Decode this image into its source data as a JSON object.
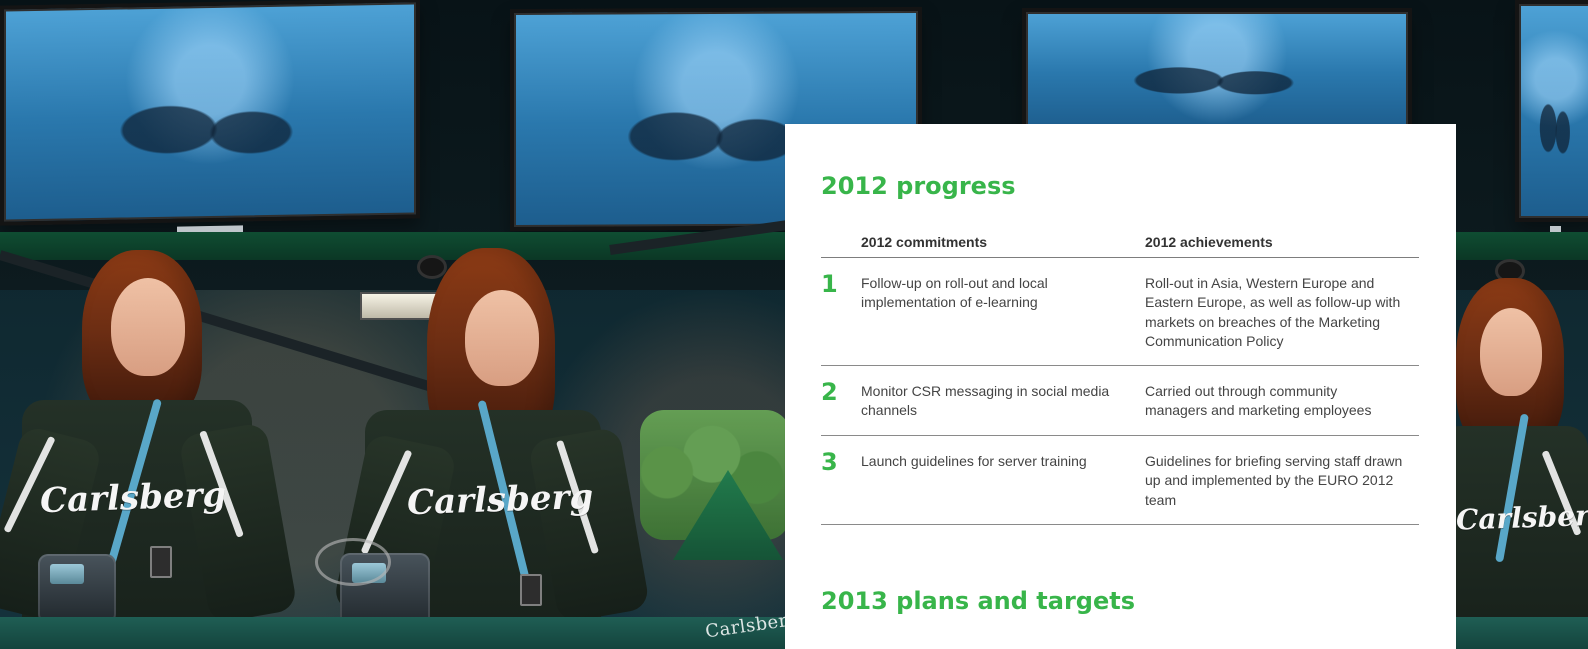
{
  "colors": {
    "accent_green": "#38b54a",
    "card_background": "#ffffff",
    "text_dark": "#444444"
  },
  "background": {
    "description_icon": "promotional-event-photo",
    "logo_text": "Carlsberg"
  },
  "progress_section": {
    "title": "2012 progress",
    "headers": {
      "commitments": "2012 commitments",
      "achievements": "2012 achievements"
    },
    "rows": [
      {
        "number": "1",
        "commitment": "Follow-up on roll-out and local implementation of e-learning",
        "achievement": "Roll-out in Asia, Western Europe and Eastern Europe, as well as follow-up with markets on breaches of the Marketing Communication Policy"
      },
      {
        "number": "2",
        "commitment": "Monitor CSR messaging in social media channels",
        "achievement": "Carried out through community managers and marketing employees"
      },
      {
        "number": "3",
        "commitment": "Launch guidelines for server training",
        "achievement": "Guidelines for briefing serving staff drawn up and implemented by the EURO 2012 team"
      }
    ]
  },
  "plans_section": {
    "title": "2013 plans and targets"
  }
}
